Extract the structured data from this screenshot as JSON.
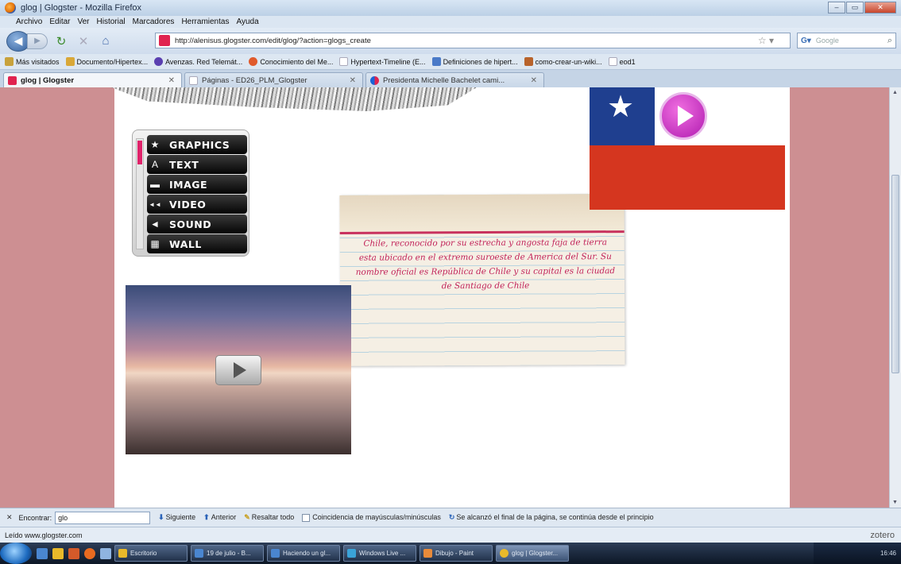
{
  "window": {
    "title": "glog | Glogster - Mozilla Firefox"
  },
  "menu": [
    "Archivo",
    "Editar",
    "Ver",
    "Historial",
    "Marcadores",
    "Herramientas",
    "Ayuda"
  ],
  "nav": {
    "url": "http://alenisus.glogster.com/edit/glog/?action=glogs_create",
    "search_placeholder": "Google",
    "search_engine_icon": "google-icon"
  },
  "bookmarks": [
    {
      "label": "Más visitados",
      "color": "#c8a23c"
    },
    {
      "label": "Documento/Hipertex...",
      "color": "#d9a838"
    },
    {
      "label": "Avenzas. Red Telemát...",
      "color": "#5a3fb0"
    },
    {
      "label": "Conocimiento del Me...",
      "color": "#e05a2c"
    },
    {
      "label": "Hypertext-Timeline (E...",
      "color": "#cfd6e0"
    },
    {
      "label": "Definiciones de hipert...",
      "color": "#4a7ac8"
    },
    {
      "label": "como-crear-un-wiki...",
      "color": "#b8632b"
    },
    {
      "label": "eod1",
      "color": "#cfd6e0"
    }
  ],
  "tabs": [
    {
      "label": "glog | Glogster",
      "color": "#e0234f",
      "active": true
    },
    {
      "label": "Páginas - ED26_PLM_Glogster",
      "color": "#cfd6e0",
      "active": false
    },
    {
      "label": "Presidenta Michelle Bachelet cami...",
      "color": "#e0234f",
      "active": false
    }
  ],
  "toolbox": {
    "tools": [
      {
        "label": "GRAPHICS",
        "icon": "star-icon",
        "glyph": "★"
      },
      {
        "label": "TEXT",
        "icon": "text-icon",
        "glyph": "A"
      },
      {
        "label": "IMAGE",
        "icon": "image-icon",
        "glyph": "▬"
      },
      {
        "label": "VIDEO",
        "icon": "video-icon",
        "glyph": "◄◄"
      },
      {
        "label": "SOUND",
        "icon": "sound-icon",
        "glyph": "◄"
      },
      {
        "label": "WALL",
        "icon": "wall-icon",
        "glyph": "▦"
      }
    ]
  },
  "note": {
    "text": "Chile, reconocido por su estrecha y angosta faja de tierra esta ubicado en el extremo suroeste de America del Sur. Su nombre oficial es República de Chile y su capital es la ciudad de Santiago de Chile"
  },
  "flag": {
    "blue": "#1f3f8f",
    "white": "#ffffff",
    "red": "#d5361f"
  },
  "findbar": {
    "label": "Encontrar:",
    "query": "glo",
    "next": "Siguiente",
    "prev": "Anterior",
    "highlight": "Resaltar todo",
    "match_case": "Coincidencia de mayúsculas/minúsculas",
    "message": "Se alcanzó el final de la página, se continúa desde el principio"
  },
  "status": {
    "text": "Leído www.glogster.com",
    "zotero": "zotero"
  },
  "taskbar": {
    "items": [
      {
        "label": "Escritorio",
        "color": "#e8b92a"
      },
      {
        "label": "19 de julio - B...",
        "color": "#4a86d0"
      },
      {
        "label": "Haciendo un gl...",
        "color": "#4a86d0"
      },
      {
        "label": "Windows Live ...",
        "color": "#3aa3d8"
      },
      {
        "label": "Dibujo - Paint",
        "color": "#e88a3a"
      },
      {
        "label": "glog | Glogster...",
        "color": "#e8b92a"
      }
    ],
    "clock": "16:46"
  },
  "colors": {
    "page_bg": "#cd8f92",
    "accent_pink": "#c2245a"
  }
}
